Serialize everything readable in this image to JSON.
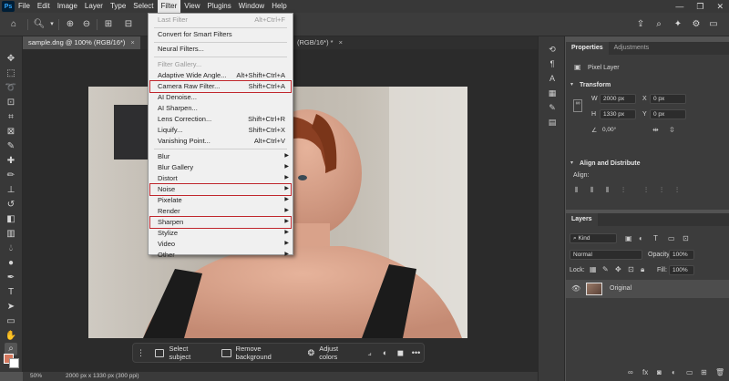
{
  "app": {
    "logo": "Ps"
  },
  "menubar": {
    "items": [
      "File",
      "Edit",
      "Image",
      "Layer",
      "Type",
      "Select",
      "Filter",
      "View",
      "Plugins",
      "Window",
      "Help"
    ],
    "active": "Filter"
  },
  "tabs": [
    {
      "label": "sample.dng @ 100% (RGB/16*)",
      "close": "×"
    },
    {
      "label": "(RGB/16*) *",
      "close": "×"
    }
  ],
  "filter_menu": {
    "items": [
      {
        "label": "Last Filter",
        "shortcut": "Alt+Ctrl+F",
        "disabled": true
      },
      {
        "label": "Convert for Smart Filters"
      },
      {
        "label": "Neural Filters..."
      },
      {
        "label": "Filter Gallery...",
        "disabled": true
      },
      {
        "label": "Adaptive Wide Angle...",
        "shortcut": "Alt+Shift+Ctrl+A"
      },
      {
        "label": "Camera Raw Filter...",
        "shortcut": "Shift+Ctrl+A",
        "highlighted": true
      },
      {
        "label": "AI Denoise..."
      },
      {
        "label": "AI Sharpen..."
      },
      {
        "label": "Lens Correction...",
        "shortcut": "Shift+Ctrl+R"
      },
      {
        "label": "Liquify...",
        "shortcut": "Shift+Ctrl+X"
      },
      {
        "label": "Vanishing Point...",
        "shortcut": "Alt+Ctrl+V"
      },
      {
        "label": "Blur",
        "submenu": true
      },
      {
        "label": "Blur Gallery",
        "submenu": true
      },
      {
        "label": "Distort",
        "submenu": true
      },
      {
        "label": "Noise",
        "submenu": true,
        "highlighted": true
      },
      {
        "label": "Pixelate",
        "submenu": true
      },
      {
        "label": "Render",
        "submenu": true
      },
      {
        "label": "Sharpen",
        "submenu": true,
        "highlighted": true
      },
      {
        "label": "Stylize",
        "submenu": true
      },
      {
        "label": "Video",
        "submenu": true
      },
      {
        "label": "Other",
        "submenu": true
      }
    ],
    "highlight_color": "#c0272d"
  },
  "taskbar": {
    "select_subject": "Select subject",
    "remove_background": "Remove background",
    "adjust_colors": "Adjust colors",
    "more": "•••"
  },
  "statusbar": {
    "zoom": "50%",
    "doc_info": "2000 px x 1330 px (300 ppi)"
  },
  "properties": {
    "tabs": [
      "Properties",
      "Adjustments"
    ],
    "layer_type": "Pixel Layer",
    "transform": {
      "heading": "Transform",
      "w_label": "W",
      "w_value": "2000 px",
      "x_label": "X",
      "x_value": "0 px",
      "h_label": "H",
      "h_value": "1330 px",
      "y_label": "Y",
      "y_value": "0 px",
      "angle_value": "0,00°"
    },
    "align": {
      "heading": "Align and Distribute",
      "align_label": "Align:"
    }
  },
  "layers": {
    "tab": "Layers",
    "kind": "Kind",
    "blend_mode": "Normal",
    "opacity_label": "Opacity:",
    "opacity_value": "100%",
    "lock_label": "Lock:",
    "fill_label": "Fill:",
    "fill_value": "100%",
    "layer_name": "Original"
  },
  "colors": {
    "foreground": "#d4785e",
    "background": "#ffffff",
    "accent": "#31a8ff"
  }
}
